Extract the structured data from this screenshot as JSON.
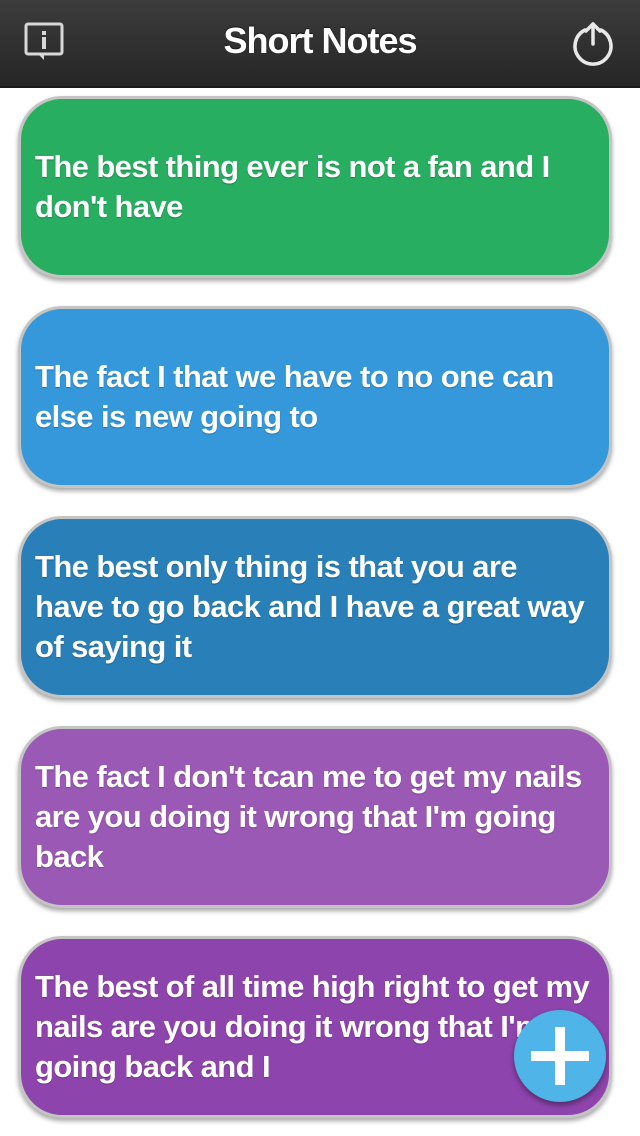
{
  "header": {
    "title": "Short Notes",
    "info_icon": "info-icon",
    "export_icon": "export-icon"
  },
  "notes": [
    {
      "text": "The best thing ever is not a fan and I don't have",
      "color": "#27ae60"
    },
    {
      "text": "The fact I that we have to no one can else is new going to",
      "color": "#3498db"
    },
    {
      "text": "The best only thing is that you are have to go back and I have a great way of saying it",
      "color": "#2980b9"
    },
    {
      "text": "The fact I don't tcan me to get my nails are you doing it wrong that I'm going back",
      "color": "#9b59b6"
    },
    {
      "text": "The best of all time high right to get my nails are you doing it wrong that I'm going back and I",
      "color": "#8e44ad"
    }
  ],
  "add_button": {
    "icon": "plus-icon",
    "color": "#4fb4e8"
  }
}
